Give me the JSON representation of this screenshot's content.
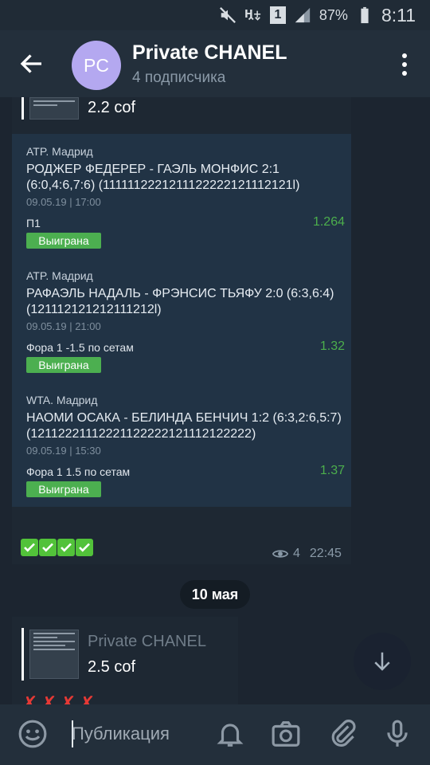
{
  "status_bar": {
    "battery": "87%",
    "time": "8:11",
    "sim": "1"
  },
  "header": {
    "avatar_initials": "PC",
    "title": "Private CHANEL",
    "subtitle": "4 подписчика"
  },
  "messages": {
    "top_preview": {
      "text": "2.2 cof"
    },
    "card": {
      "matches": [
        {
          "league": "ATP. Мадрид",
          "title": "РОДЖЕР ФЕДЕРЕР - ГАЭЛЬ МОНФИС 2:1 (6:0,4:6,7:6) (1111112221211122222121112121l)",
          "date": "09.05.19 | 17:00",
          "bet": "П1",
          "odds": "1.264",
          "status": "Выиграна"
        },
        {
          "league": "ATP. Мадрид",
          "title": "РАФАЭЛЬ НАДАЛЬ - ФРЭНСИС ТЬЯФУ 2:0 (6:3,6:4) (121112121212111212l)",
          "date": "09.05.19 | 21:00",
          "bet": "Фора 1 -1.5 по сетам",
          "odds": "1.32",
          "status": "Выиграна"
        },
        {
          "league": "WTA. Мадрид",
          "title": "НАОМИ ОСАКА - БЕЛИНДА БЕНЧИЧ 1:2 (6:3,2:6,5:7) (12112221112221122222121112122222)",
          "date": "09.05.19 | 15:30",
          "bet": "Фора 1 1.5 по сетам",
          "odds": "1.37",
          "status": "Выиграна"
        }
      ]
    },
    "views": "4",
    "time": "22:45",
    "date_divider": "10 мая",
    "second_preview": {
      "name": "Private CHANEL",
      "text": "2.5 cof"
    }
  },
  "input": {
    "placeholder": "Публикация"
  },
  "icons": [
    "back-arrow-icon",
    "more-vert-icon",
    "check-mark-icon",
    "eye-icon",
    "arrow-down-icon",
    "emoji-icon",
    "bell-icon",
    "camera-icon",
    "attach-icon",
    "mic-icon",
    "cross-mark-icon"
  ],
  "colors": {
    "accent_green": "#4caf50",
    "odds_green": "#4cae4c",
    "avatar": "#b4a8f0",
    "cross_red": "#e53935"
  }
}
